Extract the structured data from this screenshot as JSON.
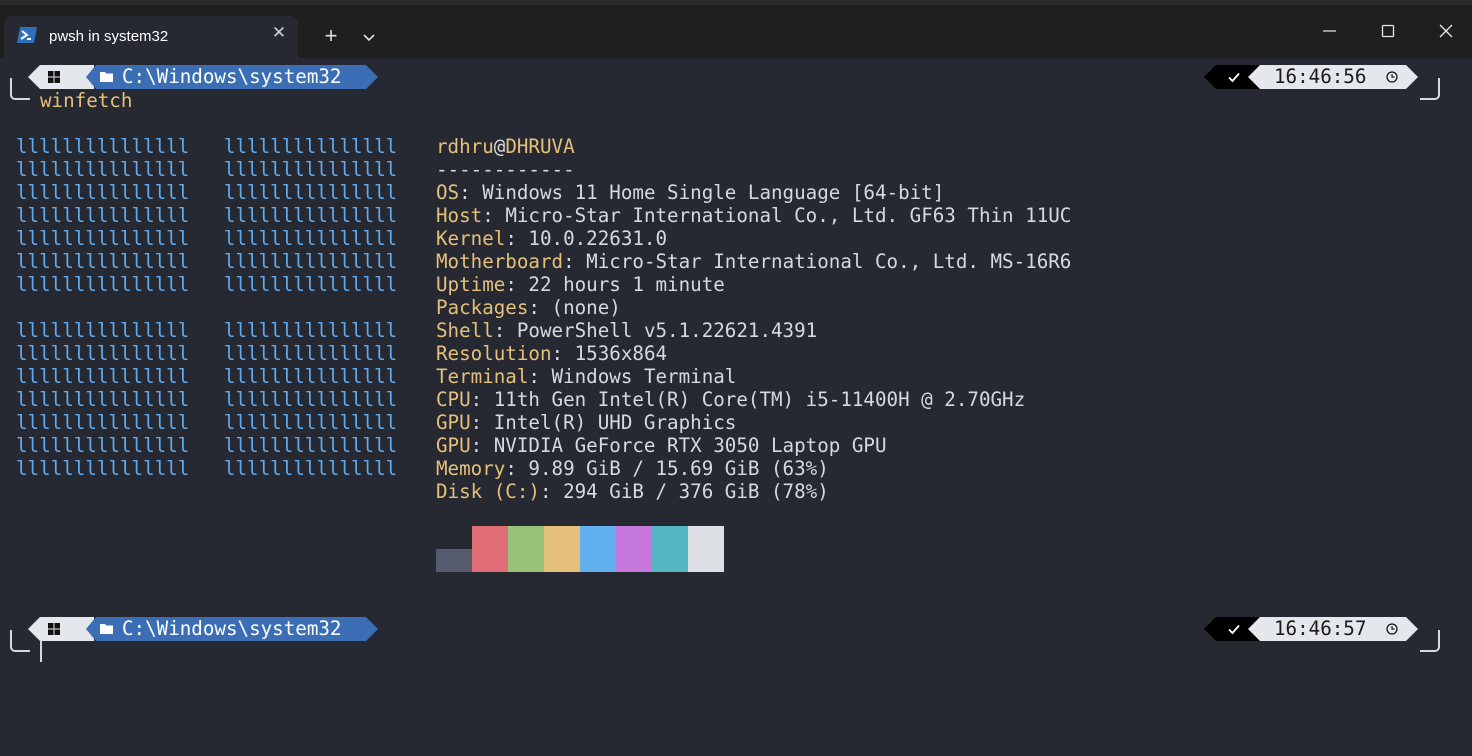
{
  "tab": {
    "title": "pwsh in system32",
    "close_glyph": "✕",
    "new_tab_glyph": "+"
  },
  "prompt1": {
    "path": "C:\\Windows\\system32",
    "time": "16:46:56"
  },
  "command": "winfetch",
  "prompt2": {
    "path": "C:\\Windows\\system32",
    "time": "16:46:57"
  },
  "logo_line": "lllllllllllllll   lllllllllllllll",
  "logo_rows": [
    0,
    1,
    2,
    3,
    4,
    5,
    6,
    8,
    9,
    10,
    11,
    12,
    13,
    14
  ],
  "sysinfo": {
    "user": "rdhru",
    "at": "@",
    "host": "DHRUVA",
    "separator": "------------",
    "fields": [
      {
        "key": "OS",
        "value": ": Windows 11 Home Single Language [64-bit]"
      },
      {
        "key": "Host",
        "value": ": Micro-Star International Co., Ltd. GF63 Thin 11UC"
      },
      {
        "key": "Kernel",
        "value": ": 10.0.22631.0"
      },
      {
        "key": "Motherboard",
        "value": ": Micro-Star International Co., Ltd. MS-16R6"
      },
      {
        "key": "Uptime",
        "value": ": 22 hours 1 minute"
      },
      {
        "key": "Packages",
        "value": ": (none)"
      },
      {
        "key": "Shell",
        "value": ": PowerShell v5.1.22621.4391"
      },
      {
        "key": "Resolution",
        "value": ": 1536x864"
      },
      {
        "key": "Terminal",
        "value": ": Windows Terminal"
      },
      {
        "key": "CPU",
        "value": ": 11th Gen Intel(R) Core(TM) i5-11400H @ 2.70GHz"
      },
      {
        "key": "GPU",
        "value": ": Intel(R) UHD Graphics"
      },
      {
        "key": "GPU",
        "value": ": NVIDIA GeForce RTX 3050 Laptop GPU"
      },
      {
        "key": "Memory",
        "value": ": 9.89 GiB / 15.69 GiB (63%)"
      },
      {
        "key": "Disk (C:)",
        "value": ": 294 GiB / 376 GiB (78%)"
      }
    ]
  },
  "palette": [
    "#565c6e",
    "#e06c75",
    "#98c379",
    "#e5c07b",
    "#61afef",
    "#c678dd",
    "#56b6c2",
    "#dcdfe4"
  ],
  "colors": {
    "background": "#262932",
    "logo": "#60a9ec",
    "key": "#e6c079",
    "path_segment": "#3b6eb5"
  }
}
